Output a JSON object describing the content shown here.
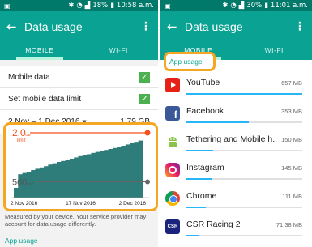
{
  "left": {
    "status": {
      "notif_icon": "notification-icon",
      "battery": "18%",
      "time": "10:58 a.m."
    },
    "appbar": {
      "title": "Data usage"
    },
    "tabs": [
      {
        "label": "MOBILE",
        "active": true
      },
      {
        "label": "WI-FI",
        "active": false
      }
    ],
    "mobile_data": {
      "label": "Mobile data",
      "checked": true
    },
    "set_limit": {
      "label": "Set mobile data limit",
      "checked": true
    },
    "cycle": {
      "label": "2 Nov – 1 Dec 2016",
      "total": "1.79 GB"
    },
    "chart_data": {
      "type": "area",
      "limit": {
        "value": "2.0",
        "unit": "GB",
        "label": "limit",
        "color": "#f4511e"
      },
      "warning": {
        "value": "500",
        "unit": "MB",
        "color": "#666666"
      },
      "x_ticks": [
        "2 Nov 2016",
        "17 Nov 2016",
        "2 Dec 2016"
      ],
      "ylim": [
        0,
        2.1
      ],
      "fill_color": "#2e7d7a",
      "cumulative_gb": [
        0.3,
        0.72,
        0.76,
        0.8,
        0.85,
        0.89,
        0.93,
        0.97,
        1.02,
        1.06,
        1.1,
        1.13,
        1.17,
        1.2,
        1.24,
        1.28,
        1.31,
        1.34,
        1.38,
        1.41,
        1.44,
        1.47,
        1.5,
        1.53,
        1.57,
        1.6,
        1.64,
        1.68,
        1.72,
        1.76
      ]
    },
    "description": "Measured by your device. Your service provider may account for data usage differently.",
    "app_usage_link": "App usage"
  },
  "right": {
    "status": {
      "notif_icon": "notification-icon",
      "battery": "30%",
      "time": "11:01 a.m."
    },
    "appbar": {
      "title": "Data usage"
    },
    "tabs": [
      {
        "label": "MOBILE",
        "active": true
      },
      {
        "label": "WI-FI",
        "active": false
      }
    ],
    "app_usage_header": "App usage",
    "apps": [
      {
        "name": "YouTube",
        "size": "657 MB",
        "fraction": 1.0,
        "icon": "youtube-icon"
      },
      {
        "name": "Facebook",
        "size": "353 MB",
        "fraction": 0.54,
        "icon": "facebook-icon"
      },
      {
        "name": "Tethering and Mobile h...",
        "size": "150 MB",
        "fraction": 0.23,
        "icon": "android-icon"
      },
      {
        "name": "Instagram",
        "size": "145 MB",
        "fraction": 0.22,
        "icon": "instagram-icon"
      },
      {
        "name": "Chrome",
        "size": "111 MB",
        "fraction": 0.17,
        "icon": "chrome-icon"
      },
      {
        "name": "CSR Racing 2",
        "size": "71.38 MB",
        "fraction": 0.11,
        "icon": "csr-racing-icon"
      }
    ]
  }
}
